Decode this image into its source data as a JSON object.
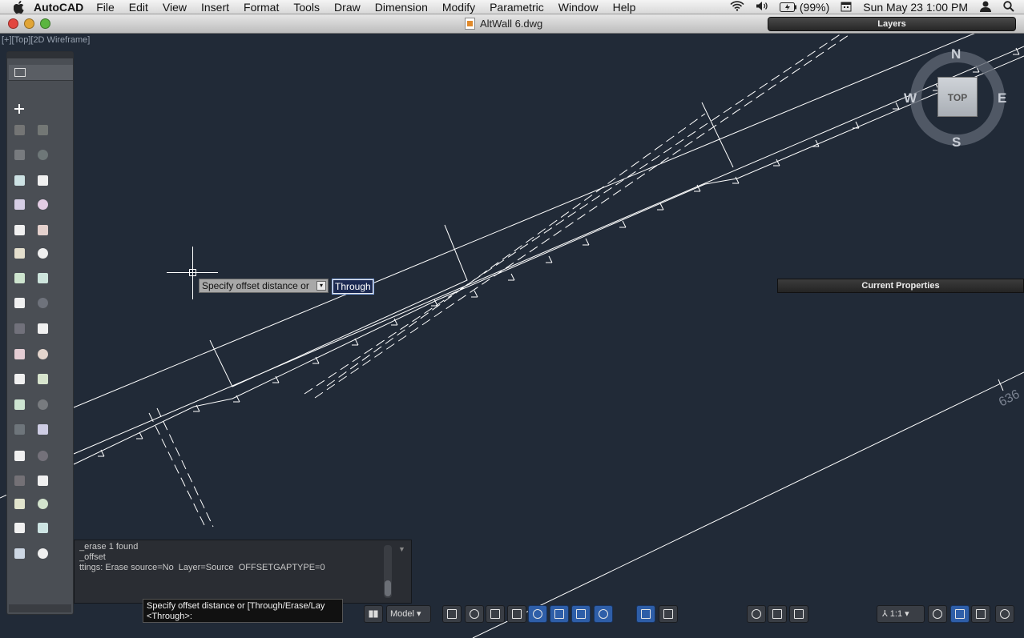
{
  "menubar": {
    "app_name": "AutoCAD",
    "items": [
      "File",
      "Edit",
      "View",
      "Insert",
      "Format",
      "Tools",
      "Draw",
      "Dimension",
      "Modify",
      "Parametric",
      "Window",
      "Help"
    ],
    "battery": "(99%)",
    "clock": "Sun May 23  1:00 PM"
  },
  "window": {
    "title": "AltWall 6.dwg"
  },
  "panels": {
    "layers_title": "Layers",
    "current_properties_title": "Current Properties"
  },
  "viewport": {
    "label": "[+][Top][2D Wireframe]",
    "dimension_text": "636"
  },
  "viewcube": {
    "face_label": "TOP",
    "north": "N",
    "south": "S",
    "east": "E",
    "west": "W"
  },
  "dynamic_input": {
    "prompt": "Specify offset distance or",
    "value": "Through"
  },
  "command_line": {
    "history": [
      "_erase 1 found",
      "",
      "_offset",
      "ttings: Erase source=No  Layer=Source  OFFSETGAPTYPE=0"
    ],
    "input_line1": "Specify offset distance or [Through/Erase/Lay",
    "input_line2": "<Through>:"
  },
  "statusbar": {
    "model_label": "Model",
    "scale_label": "1:1"
  },
  "colors": {
    "viewport_bg": "#212a37",
    "linework": "#ffffff",
    "toolbar_bg": "#4a4e54",
    "accent": "#2e5ea8"
  },
  "icons": {
    "toolbar_tools": [
      "select-icon",
      "point-icon",
      "line-icon",
      "polyline-icon",
      "spline-icon",
      "rectangle-icon",
      "circle-icon",
      "arc-icon",
      "ellipse-icon",
      "hatch-icon",
      "text-icon",
      "mtext-icon",
      "dimension-icon",
      "leader-icon",
      "block-icon",
      "insert-icon",
      "move-icon",
      "rotate-icon",
      "scale-icon",
      "stretch-icon",
      "copy-icon",
      "array-icon",
      "mirror-icon",
      "offset-icon",
      "fillet-icon",
      "chamfer-icon",
      "trim-icon",
      "extend-icon",
      "break-icon",
      "join-icon",
      "explode-icon",
      "erase-icon",
      "properties-icon",
      "match-properties-icon",
      "layer-icon",
      "layer-off-icon",
      "measure-icon",
      "area-icon",
      "render-icon",
      "undo-icon"
    ],
    "statusbar_tools": [
      "snap-icon",
      "grid-display-icon",
      "grid-icon",
      "ortho-icon",
      "polar-icon",
      "object-snap-icon",
      "object-snap-tracking-icon",
      "dynamic-ucs-icon",
      "dynamic-input-icon",
      "lineweight-icon",
      "quick-properties-icon",
      "pan-icon",
      "zoom-icon",
      "steering-wheel-icon",
      "annotation-visibility-icon",
      "auto-scale-icon",
      "workspace-icon"
    ]
  }
}
